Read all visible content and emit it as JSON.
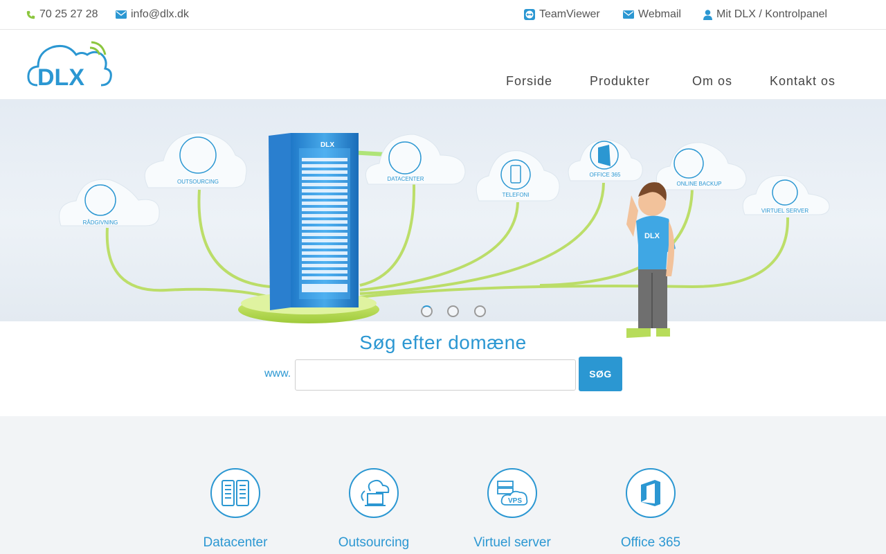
{
  "topbar": {
    "phone": "70 25 27 28",
    "email": "info@dlx.dk",
    "teamviewer": "TeamViewer",
    "webmail": "Webmail",
    "account": "Mit DLX / Kontrolpanel"
  },
  "brand": {
    "logo_text": "DLX",
    "primary_color": "#2b97d2",
    "accent_color": "#8cc63f"
  },
  "nav": {
    "items": [
      "Forside",
      "Produkter",
      "Om os",
      "Kontakt os"
    ]
  },
  "hero": {
    "clouds": [
      "RÅDGIVNING",
      "OUTSOURCING",
      "DATACENTER",
      "TELEFONI",
      "OFFICE 365",
      "ONLINE BACKUP",
      "VIRTUEL SERVER"
    ],
    "slides": 3,
    "active_slide": 1,
    "shirt_text": "DLX",
    "rack_text": "DLX"
  },
  "domain_search": {
    "title": "Søg efter domæne",
    "prefix": "www.",
    "value": "",
    "button": "SØG"
  },
  "services": {
    "items": [
      {
        "label": "Datacenter",
        "icon": "server-rack-icon"
      },
      {
        "label": "Outsourcing",
        "icon": "cloud-laptop-icon"
      },
      {
        "label": "Virtuel server",
        "icon": "vps-cloud-icon"
      },
      {
        "label": "Office 365",
        "icon": "office-365-icon"
      }
    ]
  }
}
